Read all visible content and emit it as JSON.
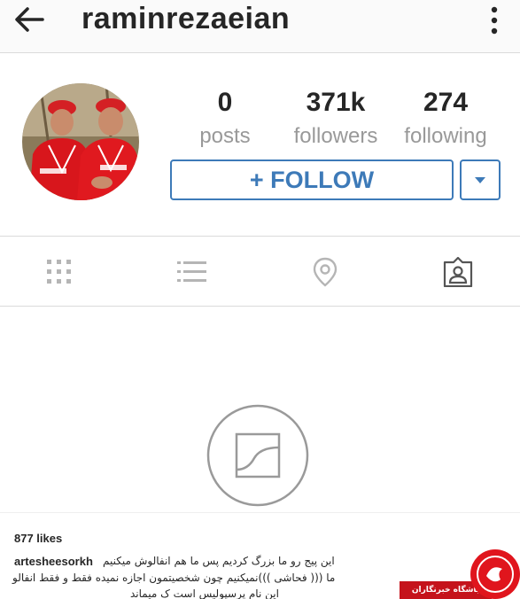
{
  "header": {
    "back_icon": "arrow-left-icon",
    "username": "raminrezaeian",
    "more_icon": "more-vertical-icon"
  },
  "profile": {
    "stats": [
      {
        "value": "0",
        "label": "posts"
      },
      {
        "value": "371k",
        "label": "followers"
      },
      {
        "value": "274",
        "label": "following"
      }
    ],
    "follow_label": "+ FOLLOW",
    "accent_color": "#3d7ab8"
  },
  "tabs": [
    {
      "icon": "grid-icon"
    },
    {
      "icon": "list-icon"
    },
    {
      "icon": "location-pin-icon"
    },
    {
      "icon": "tagged-person-icon"
    }
  ],
  "empty_state": {
    "icon": "photo-placeholder-icon"
  },
  "post": {
    "likes": "877 likes",
    "caption_user": "artesheesorkh",
    "caption_lines": [
      "این پیج رو ما بزرگ کردیم پس ما هم انفالوش میکنیم",
      "ما ((( فحاشی )))نمیکنیم چون شخصیتمون اجازه نمیده فقط و فقط انفالو",
      "این نام پرسپولیس است ک میماند"
    ]
  },
  "watermark": {
    "text": "باشگاه خبرنگاران",
    "logo_icon": "news-agency-logo-icon",
    "brand_color": "#c5131b"
  }
}
